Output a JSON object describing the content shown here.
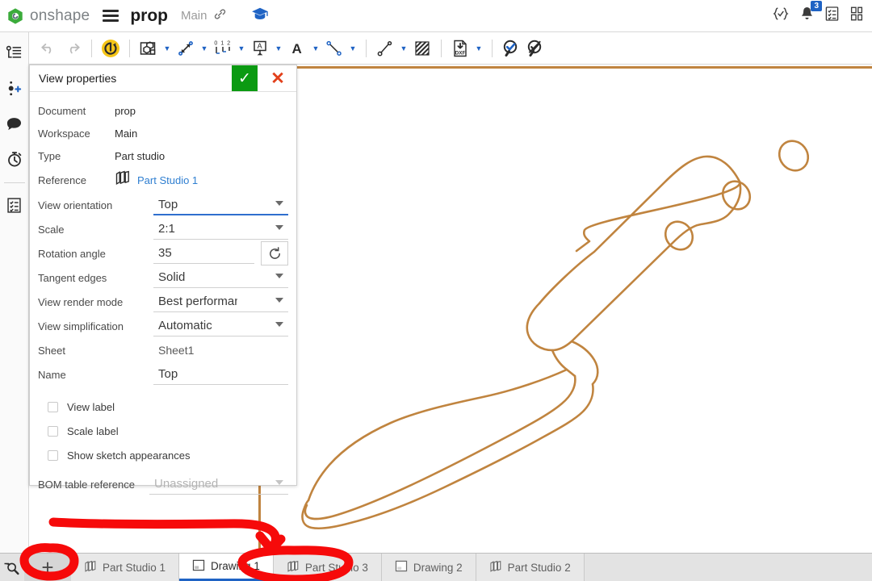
{
  "topbar": {
    "brand": "onshape",
    "menu_icon": "hamburger-icon",
    "document_title": "prop",
    "workspace": "Main",
    "link_icon": "link-icon",
    "learning_icon": "graduation-cap-icon",
    "right_icons": [
      {
        "name": "braces-check-icon",
        "glyph": "{✓}"
      },
      {
        "name": "notifications-bell-icon",
        "glyph": "bell",
        "badge": "3"
      },
      {
        "name": "tasks-list-icon",
        "glyph": "checklist"
      },
      {
        "name": "panels-layout-icon",
        "glyph": "panels"
      }
    ]
  },
  "leftrail": {
    "items": [
      {
        "name": "sidebar-item-feature-list",
        "label": "Feature list"
      },
      {
        "name": "sidebar-item-insert-version",
        "label": "Insert version"
      },
      {
        "name": "sidebar-item-comments",
        "label": "Comments"
      },
      {
        "name": "sidebar-item-history",
        "label": "History"
      },
      {
        "name": "sidebar-item-properties",
        "label": "Properties"
      }
    ]
  },
  "toolbar": {
    "undo_label": "Undo",
    "redo_label": "Redo",
    "update_views_label": "Update views",
    "insert_view_label": "Insert view",
    "dimension_label": "Dimension",
    "ordinate_dimension_label": "Ordinate dimension",
    "note_label": "Note",
    "text_label": "Text",
    "centerline_label": "Centerline",
    "leader_label": "Leader",
    "hatch_label": "Area hatch",
    "export_dxf_label": "Export DXF",
    "check_label": "Check drawing",
    "uncheck_label": "Hide checks",
    "ordinate_glyph": "0 1 2"
  },
  "panel": {
    "title": "View properties",
    "accept_label": "✓",
    "cancel_label": "✕",
    "info": [
      {
        "label": "Document",
        "value": "prop"
      },
      {
        "label": "Workspace",
        "value": "Main"
      },
      {
        "label": "Type",
        "value": "Part studio"
      }
    ],
    "reference": {
      "label": "Reference",
      "value": "Part Studio 1"
    },
    "fields": [
      {
        "label": "View orientation",
        "value": "Top",
        "kind": "select",
        "focused": true,
        "disabled": false
      },
      {
        "label": "Scale",
        "value": "2:1",
        "kind": "select",
        "focused": false,
        "disabled": false
      },
      {
        "label": "Rotation angle",
        "value": "35",
        "kind": "text",
        "focused": false,
        "disabled": false
      },
      {
        "label": "Tangent edges",
        "value": "Solid",
        "kind": "select",
        "focused": false,
        "disabled": false
      },
      {
        "label": "View render mode",
        "value": "Best performance",
        "kind": "select",
        "focused": false,
        "disabled": false
      },
      {
        "label": "View simplification",
        "value": "Automatic",
        "kind": "select",
        "focused": false,
        "disabled": false
      },
      {
        "label": "Sheet",
        "value": "Sheet1",
        "kind": "static",
        "focused": false,
        "disabled": false
      },
      {
        "label": "Name",
        "value": "Top",
        "kind": "text",
        "focused": false,
        "disabled": false
      }
    ],
    "reset_rotation_label": "Reset rotation",
    "checkboxes": [
      {
        "label": "View label",
        "checked": false
      },
      {
        "label": "Scale label",
        "checked": false
      },
      {
        "label": "Show sketch appearances",
        "checked": false
      }
    ],
    "bom": {
      "label": "BOM table reference",
      "value": "Unassigned",
      "disabled": true
    }
  },
  "canvas": {
    "sheet_name": "Sheet1",
    "drawing_line_color": "#c0843f",
    "view_name": "Top"
  },
  "tabbar": {
    "zoom_icon": "zoom-search-icon",
    "add_label": "+",
    "tabs": [
      {
        "label": "Part Studio 1",
        "type": "part-studio",
        "active": false
      },
      {
        "label": "Drawing 1",
        "type": "drawing",
        "active": true
      },
      {
        "label": "Part Studio 3",
        "type": "part-studio",
        "active": false
      },
      {
        "label": "Drawing 2",
        "type": "drawing",
        "active": false
      },
      {
        "label": "Part Studio 2",
        "type": "part-studio",
        "active": false
      }
    ]
  },
  "annotation": {
    "color": "#f60a0a",
    "circle_add_tab": "new-tab-button",
    "circle_drawing_tab": "Drawing 1",
    "arrow": "arrow-to-drawing-1-tab"
  },
  "colors": {
    "accent_blue": "#1f63c4",
    "ok_green": "#0b9a12",
    "cancel_red": "#e2401b",
    "annotation_red": "#f60a0a",
    "drawing_brown": "#c0843f",
    "brand_green": "#3bab3b"
  }
}
